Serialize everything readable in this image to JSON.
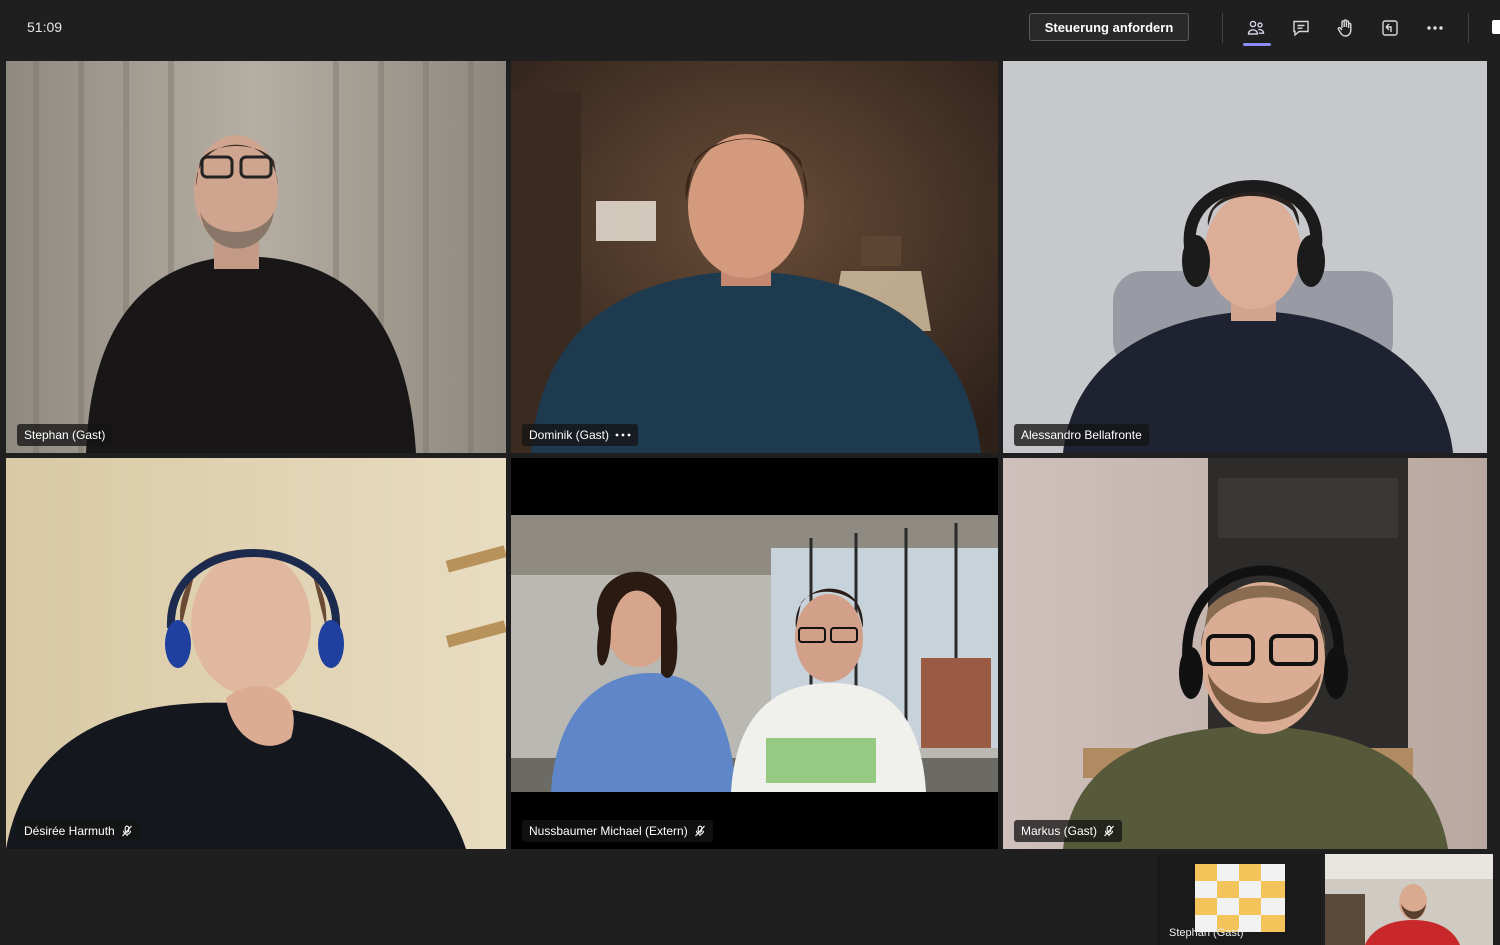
{
  "meeting": {
    "timer": "51:09",
    "request_control_label": "Steuerung anfordern"
  },
  "toolbar": {
    "icons": [
      "participants-icon",
      "chat-icon",
      "raise-hand-icon",
      "share-tray-icon",
      "more-actions-icon"
    ],
    "active": "participants-icon",
    "active_color": "#8b8cf5"
  },
  "participants": [
    {
      "name": "Stephan (Gast)",
      "mic_muted": false,
      "has_more": false
    },
    {
      "name": "Dominik (Gast)",
      "mic_muted": false,
      "has_more": true
    },
    {
      "name": "Alessandro Bellafronte",
      "mic_muted": false,
      "has_more": false
    },
    {
      "name": "Désirée Harmuth",
      "mic_muted": true,
      "has_more": false
    },
    {
      "name": "Nussbaumer Michael (Extern)",
      "mic_muted": true,
      "has_more": false
    },
    {
      "name": "Markus (Gast)",
      "mic_muted": true,
      "has_more": false
    }
  ],
  "shared_content_thumbnail": {
    "label": "Stephan (Gast)"
  }
}
